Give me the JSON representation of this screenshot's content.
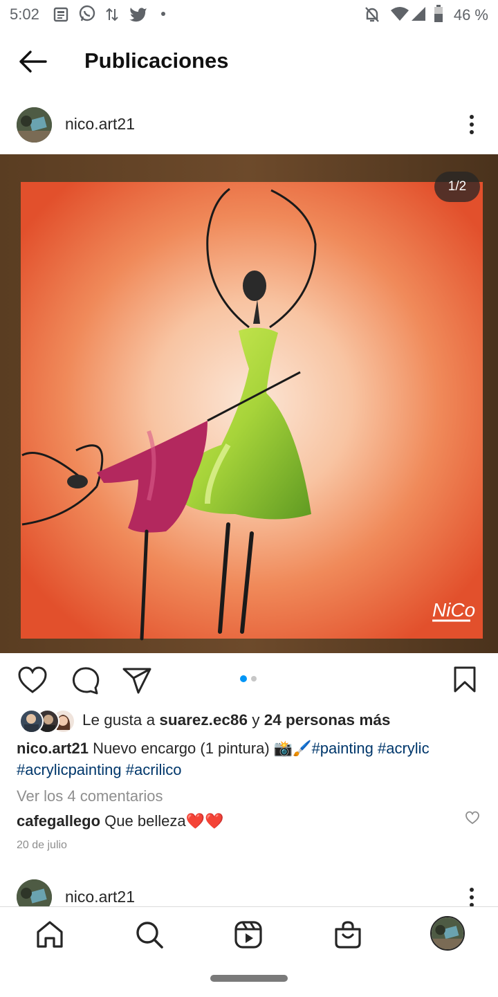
{
  "status_bar": {
    "time": "5:02",
    "battery_percent": "46 %",
    "icons": [
      "news-icon",
      "whatsapp-icon",
      "data-arrows-icon",
      "twitter-icon",
      "dot-icon",
      "dnd-off-icon",
      "wifi-icon",
      "signal-icon",
      "battery-icon"
    ]
  },
  "header": {
    "title": "Publicaciones",
    "back_icon": "back-arrow-icon"
  },
  "post": {
    "username": "nico.art21",
    "image_counter": "1/2",
    "painting_signature": "NiCo",
    "carousel": {
      "current": 1,
      "total": 2
    },
    "likes": {
      "prefix": "Le gusta a",
      "user": "suarez.ec86",
      "conj": "y",
      "others": "24 personas más"
    },
    "caption": {
      "username": "nico.art21",
      "text": "Nuevo encargo (1 pintura) 📸🖌️",
      "hashtags": [
        "#painting",
        "#acrylic",
        "#acrylicpainting",
        "#acrilico"
      ]
    },
    "view_comments": "Ver los 4 comentarios",
    "comment": {
      "username": "cafegallego",
      "text": "Que belleza❤️❤️"
    },
    "date": "20 de julio"
  },
  "next_post": {
    "username": "nico.art21"
  },
  "bottom_nav": {
    "items": [
      "home-icon",
      "search-icon",
      "reels-icon",
      "shop-icon",
      "profile-avatar"
    ]
  },
  "colors": {
    "accent_blue": "#0095f6",
    "link": "#00376b",
    "muted": "#8e8e8e"
  }
}
